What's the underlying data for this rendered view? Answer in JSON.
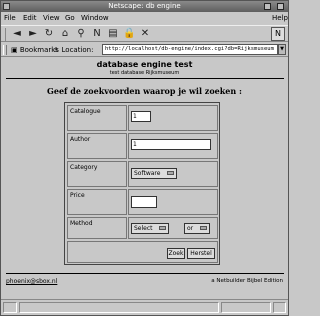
{
  "window": {
    "title": "Netscape: db engine"
  },
  "menu": {
    "file": "File",
    "edit": "Edit",
    "view": "View",
    "go": "Go",
    "window": "Window",
    "help": "Help"
  },
  "toolbar": {
    "icons": [
      "back-icon",
      "forward-icon",
      "reload-icon",
      "home-icon",
      "search-icon",
      "netscape-icon",
      "print-icon",
      "security-icon",
      "stop-icon"
    ]
  },
  "location": {
    "bookmarks_label": "Bookmarks",
    "location_label": "Location:",
    "url": "http://localhost/db-engine/index.cgi?db=Rijksmuseum"
  },
  "page": {
    "app_title": "database engine test",
    "app_subtitle": "test database Rijksmuseum",
    "heading": "Geef de zoekvoorden waarop je wil zoeken :"
  },
  "form": {
    "fields": {
      "catalogue_label": "Catalogue",
      "catalogue_value": "1",
      "author_label": "Author",
      "author_value": "1",
      "category_label": "Category",
      "category_value": "Software",
      "price_label": "Price",
      "price_value": "",
      "method_label": "Method",
      "method_value": "Select",
      "order_value": "or"
    },
    "buttons": {
      "submit": "Zoek",
      "reset": "Herstel"
    }
  },
  "footer": {
    "link": "phoenix@sbox.nl",
    "right": "a Netbuilder Bijbel Edition"
  },
  "status": {
    "text": ""
  }
}
